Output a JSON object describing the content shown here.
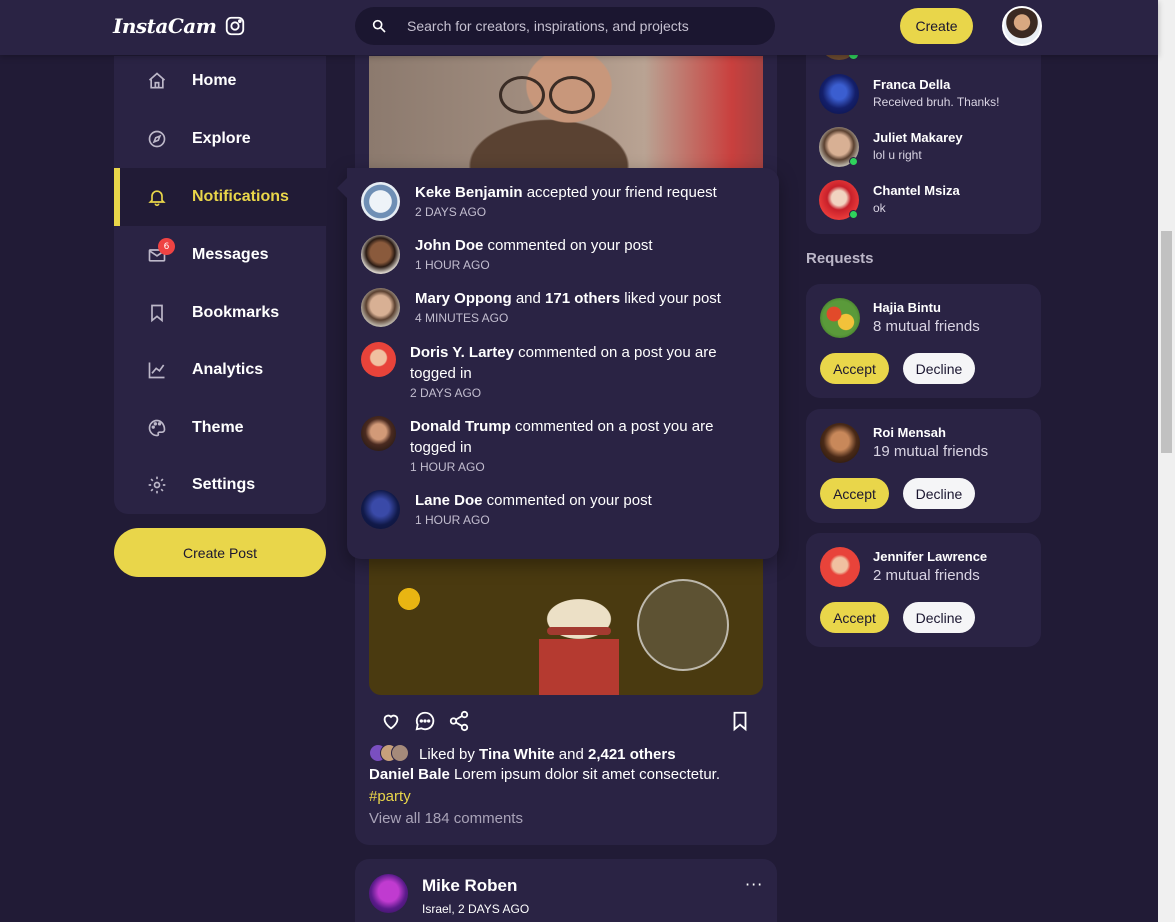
{
  "brand": {
    "name": "InstaCam",
    "logo_icon": "instagram-icon"
  },
  "search": {
    "placeholder": "Search for creators, inspirations, and projects",
    "icon": "search-icon"
  },
  "header": {
    "create_label": "Create"
  },
  "sidebar": {
    "items": [
      {
        "label": "Home",
        "icon": "home-icon"
      },
      {
        "label": "Explore",
        "icon": "compass-icon"
      },
      {
        "label": "Notifications",
        "icon": "bell-icon",
        "active": true
      },
      {
        "label": "Messages",
        "icon": "envelope-icon",
        "badge": "6"
      },
      {
        "label": "Bookmarks",
        "icon": "bookmark-icon"
      },
      {
        "label": "Analytics",
        "icon": "chart-line-icon"
      },
      {
        "label": "Theme",
        "icon": "palette-icon"
      },
      {
        "label": "Settings",
        "icon": "gear-icon"
      }
    ],
    "create_post_label": "Create Post"
  },
  "notifications": [
    {
      "name": "Keke Benjamin",
      "text": " accepted your friend request",
      "time": "2 DAYS AGO"
    },
    {
      "name": "John Doe",
      "text": " commented on your post",
      "time": "1 HOUR AGO"
    },
    {
      "name": "Mary Oppong",
      "mid": " and ",
      "others": "171 others",
      "text": " liked your post",
      "time": "4 MINUTES AGO"
    },
    {
      "name": "Doris Y. Lartey",
      "text": " commented on a post you are togged in",
      "time": "2 DAYS AGO"
    },
    {
      "name": "Donald Trump",
      "text": " commented on a post you are togged in",
      "time": "1 HOUR AGO"
    },
    {
      "name": "Lane Doe",
      "text": " commented on your post",
      "time": "1 HOUR AGO"
    }
  ],
  "post": {
    "liked_prefix": "Liked by ",
    "liked_user": "Tina White",
    "liked_mid": " and ",
    "liked_count": "2,421 others",
    "caption_user": "Daniel Bale",
    "caption_text": " Lorem ipsum dolor sit amet consectetur.",
    "hashtag": "#party",
    "view_comments": "View all 184 comments"
  },
  "post2": {
    "name": "Mike Roben",
    "meta": "Israel, 2 DAYS AGO",
    "more": "···"
  },
  "messages": [
    {
      "name": "Franca Della",
      "text": "Received bruh. Thanks!",
      "online": false
    },
    {
      "name": "Juliet Makarey",
      "text": "lol u right",
      "online": true
    },
    {
      "name": "Chantel Msiza",
      "text": "ok",
      "online": true
    }
  ],
  "requests": {
    "title": "Requests",
    "accept_label": "Accept",
    "decline_label": "Decline",
    "items": [
      {
        "name": "Hajia Bintu",
        "mutual": "8 mutual friends"
      },
      {
        "name": "Roi Mensah",
        "mutual": "19 mutual friends"
      },
      {
        "name": "Jennifer Lawrence",
        "mutual": "2 mutual friends"
      }
    ]
  },
  "colors": {
    "accent": "#e9d64a",
    "bg": "#211b36",
    "card": "#2a2344",
    "badge": "#ef4343",
    "online": "#2fd35c"
  }
}
